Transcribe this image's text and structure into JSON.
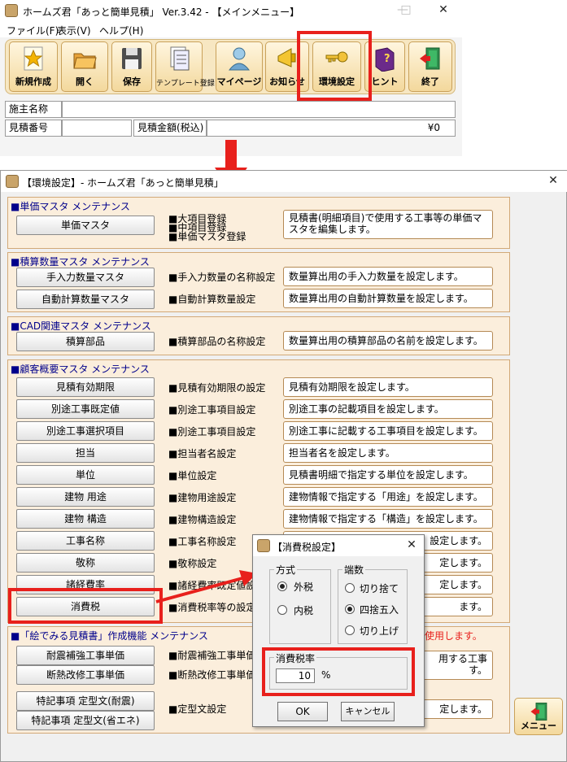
{
  "main": {
    "title": "ホームズ君「あっと簡単見積」 Ver.3.42 - 【メインメニュー】",
    "controls": {
      "minimize": "—",
      "maximize": "□",
      "close": "✕"
    },
    "menu": [
      "ファイル(F)",
      "表示(V)",
      "ヘルプ(H)"
    ],
    "toolbar": [
      {
        "label": "新規作成",
        "icon": "new-star-icon"
      },
      {
        "label": "開く",
        "icon": "folder-open-icon"
      },
      {
        "label": "保存",
        "icon": "save-disk-icon"
      },
      {
        "label": "テンプレート登録",
        "icon": "template-icon"
      },
      {
        "label": "マイページ",
        "icon": "user-icon"
      },
      {
        "label": "お知らせ",
        "icon": "megaphone-icon"
      },
      {
        "label": "環境設定",
        "icon": "key-icon"
      },
      {
        "label": "ヒント",
        "icon": "help-book-icon"
      },
      {
        "label": "終了",
        "icon": "exit-door-icon"
      }
    ],
    "fields": {
      "owner_label": "施主名称",
      "estimate_no_label": "見積番号",
      "amount_label": "見積金額(税込)",
      "amount_value": "¥0"
    }
  },
  "settings": {
    "title": "【環境設定】- ホームズ君「あっと簡単見積」",
    "close": "✕",
    "panels": {
      "unit_master": {
        "title": "■単価マスタ メンテナンス",
        "button": "単価マスタ",
        "bullets": [
          "■大項目登録",
          "■中項目登録",
          "■単価マスタ登録"
        ],
        "desc": "見積書(明細項目)で使用する工事等の単価マスタを編集します。"
      },
      "quantity_master": {
        "title": "■積算数量マスタ メンテナンス",
        "rows": [
          {
            "button": "手入力数量マスタ",
            "bullet": "■手入力数量の名称設定",
            "desc": "数量算出用の手入力数量を設定します。"
          },
          {
            "button": "自動計算数量マスタ",
            "bullet": "■自動計算数量設定",
            "desc": "数量算出用の自動計算数量を設定します。"
          }
        ]
      },
      "cad_master": {
        "title": "■CAD関連マスタ メンテナンス",
        "rows": [
          {
            "button": "積算部品",
            "bullet": "■積算部品の名称設定",
            "desc": "数量算出用の積算部品の名前を設定します。"
          }
        ]
      },
      "customer_master": {
        "title": "■顧客概要マスタ メンテナンス",
        "rows": [
          {
            "button": "見積有効期限",
            "bullet": "■見積有効期限の設定",
            "desc": "見積有効期限を設定します。"
          },
          {
            "button": "別途工事既定値",
            "bullet": "■別途工事項目設定",
            "desc": "別途工事の記載項目を設定します。"
          },
          {
            "button": "別途工事選択項目",
            "bullet": "■別途工事項目設定",
            "desc": "別途工事に記載する工事項目を設定します。"
          },
          {
            "button": "担当",
            "bullet": "■担当者名設定",
            "desc": "担当者名を設定します。"
          },
          {
            "button": "単位",
            "bullet": "■単位設定",
            "desc": "見積書明細で指定する単位を設定します。"
          },
          {
            "button": "建物 用途",
            "bullet": "■建物用途設定",
            "desc": "建物情報で指定する「用途」を設定します。"
          },
          {
            "button": "建物 構造",
            "bullet": "■建物構造設定",
            "desc": "建物情報で指定する「構造」を設定します。"
          },
          {
            "button": "工事名称",
            "bullet": "■工事名称設定",
            "desc": "設定します。"
          },
          {
            "button": "敬称",
            "bullet": "■敬称設定",
            "desc": "定します。"
          },
          {
            "button": "諸経費率",
            "bullet": "■諸経費率既定値設",
            "desc": "定します。"
          },
          {
            "button": "消費税",
            "bullet": "■消費税率等の設定",
            "desc": "ます。"
          }
        ]
      },
      "picture_estimate": {
        "title": "■「絵でみる見積書」作成機能 メンテナンス",
        "title_tail": "使用します。",
        "rows": [
          {
            "button": "耐震補強工事単価",
            "bullet": "■耐震補強工事単価"
          },
          {
            "button": "断熱改修工事単価",
            "bullet": "■断熱改修工事単価"
          }
        ],
        "desc_lines": [
          "用する工事",
          "す。"
        ],
        "special": {
          "buttons": [
            "特記事項 定型文(耐震)",
            "特記事項 定型文(省エネ)"
          ],
          "bullet": "■定型文設定",
          "desc": "定します。"
        }
      }
    },
    "menu_button": "メニュー"
  },
  "tax_dialog": {
    "title": "【消費税設定】",
    "close": "✕",
    "method": {
      "title": "方式",
      "options": [
        "外税",
        "内税"
      ],
      "selected": 0
    },
    "rounding": {
      "title": "端数",
      "options": [
        "切り捨て",
        "四捨五入",
        "切り上げ"
      ],
      "selected": 1
    },
    "rate": {
      "title": "消費税率",
      "value": "10",
      "unit": "%"
    },
    "ok": "OK",
    "cancel": "キャンセル"
  },
  "colors": {
    "highlight": "#e8201c",
    "panel_bg": "#fbeedc",
    "panel_title": "#00008b"
  }
}
